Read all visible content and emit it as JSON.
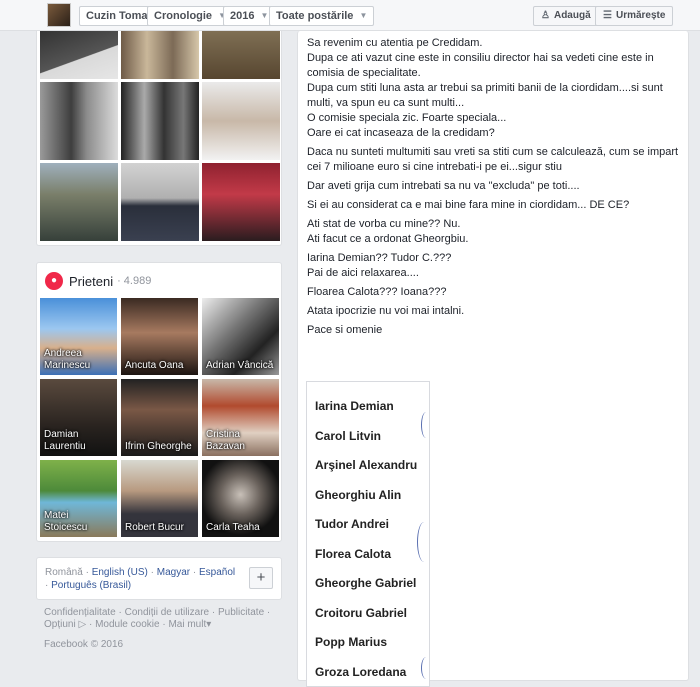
{
  "topbar": {
    "profile_name": "Cuzin Toma",
    "timeline_label": "Cronologie",
    "year_label": "2016",
    "filter_label": "Toate postările",
    "add_label": "Adaugă",
    "follow_label": "Urmărește"
  },
  "friends": {
    "title": "Prieteni",
    "count": "· 4.989",
    "items": [
      {
        "name": "Andreea Marinescu"
      },
      {
        "name": "Ancuta Oana"
      },
      {
        "name": "Adrian Vâncică"
      },
      {
        "name": "Damian Laurentiu"
      },
      {
        "name": "Ifrim Gheorghe"
      },
      {
        "name": "Cristina Bazavan"
      },
      {
        "name": "Matei Stoicescu"
      },
      {
        "name": "Robert Bucur"
      },
      {
        "name": "Carla Teaha"
      }
    ]
  },
  "languages": {
    "current": "Română",
    "options": [
      "English (US)",
      "Magyar",
      "Español",
      "Português (Brasil)"
    ],
    "more_symbol": "+"
  },
  "footer": {
    "links": [
      "Confidențialitate",
      "Condiții de utilizare",
      "Publicitate",
      "Opțiuni",
      "Module cookie",
      "Mai mult"
    ],
    "copyright": "Facebook © 2016"
  },
  "post": {
    "paragraphs": [
      [
        "Sa revenim cu atentia pe Credidam.",
        "Dupa ce ati vazut cine este in consiliu director hai sa vedeti cine este in comisia de specialitate.",
        "Dupa cum stiti luna asta ar trebui sa primiti banii de la ciordidam....si sunt multi, va spun eu ca sunt multi...",
        "O comisie speciala zic. Foarte speciala...",
        "Oare ei cat incaseaza de la credidam?"
      ],
      [
        "Daca nu sunteti multumiti sau vreti sa stiti cum se calculează, cum se impart cei 7 milioane euro si cine intrebati-i pe ei...sigur stiu"
      ],
      [
        "Dar aveti grija cum intrebati sa nu va \"excluda\" pe toti...."
      ],
      [
        "Si ei au considerat ca e mai bine fara mine in ciordidam... DE CE?"
      ],
      [
        "Ati stat de vorba cu mine?? Nu.",
        "Ati facut ce a ordonat Gheorgbiu."
      ],
      [
        "Iarina Demian?? Tudor C.???",
        "Pai de aici relaxarea...."
      ],
      [
        "Floarea Calota??? Ioana???"
      ],
      [
        "Atata ipocrizie nu voi mai intalni."
      ],
      [
        "Pace si omenie"
      ]
    ],
    "image_names": [
      "Iarina Demian",
      "Carol Litvin",
      "Arşinel Alexandru",
      "Gheorghiu Alin",
      "Tudor Andrei",
      "Florea Calota",
      "Gheorghe Gabriel",
      "Croitoru Gabriel",
      "Popp Marius",
      "Groza Loredana"
    ]
  },
  "colors": {
    "link": "#365899",
    "friends_icon": "#f02849",
    "page_bg": "#e9ebee"
  }
}
